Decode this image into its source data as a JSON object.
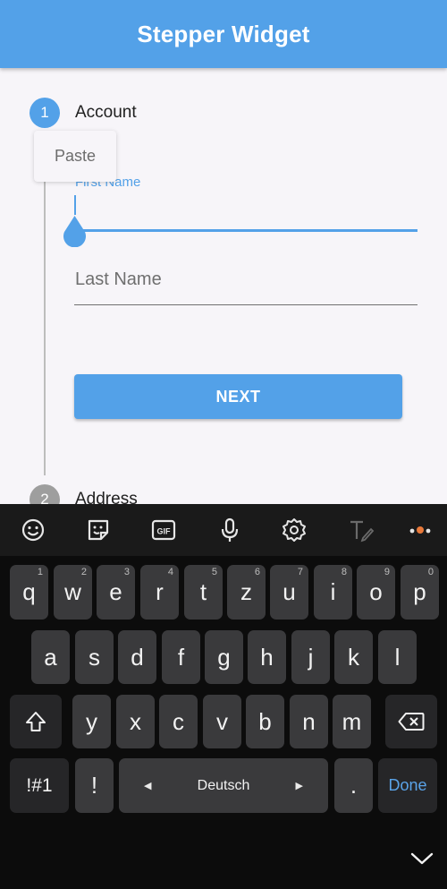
{
  "appbar": {
    "title": "Stepper Widget"
  },
  "stepper": {
    "steps": [
      {
        "number": "1",
        "title": "Account"
      },
      {
        "number": "2",
        "title": "Address"
      }
    ],
    "paste_menu_label": "Paste",
    "first_name": {
      "label": "First Name",
      "value": ""
    },
    "last_name": {
      "placeholder": "Last Name",
      "value": ""
    },
    "next_button": "NEXT"
  },
  "colors": {
    "primary": "#53a1e8",
    "inactive_step": "#9e9e9e",
    "keyboard_bg": "#0c0c0c",
    "key_bg": "#3a3a3c",
    "notification_dot": "#e8793a"
  },
  "keyboard": {
    "toolbar_icons": [
      "emoji-icon",
      "sticker-icon",
      "gif-icon",
      "mic-icon",
      "settings-icon",
      "handwriting-icon",
      "more-icon"
    ],
    "toolbar_gif_label": "GIF",
    "row1": [
      {
        "k": "q",
        "n": "1"
      },
      {
        "k": "w",
        "n": "2"
      },
      {
        "k": "e",
        "n": "3"
      },
      {
        "k": "r",
        "n": "4"
      },
      {
        "k": "t",
        "n": "5"
      },
      {
        "k": "z",
        "n": "6"
      },
      {
        "k": "u",
        "n": "7"
      },
      {
        "k": "i",
        "n": "8"
      },
      {
        "k": "o",
        "n": "9"
      },
      {
        "k": "p",
        "n": "0"
      }
    ],
    "row2": [
      "a",
      "s",
      "d",
      "f",
      "g",
      "h",
      "j",
      "k",
      "l"
    ],
    "row3": [
      "y",
      "x",
      "c",
      "v",
      "b",
      "n",
      "m"
    ],
    "symbols_key": "!#1",
    "exclaim_key": "!",
    "space_label": "Deutsch",
    "period_key": ".",
    "done_key": "Done"
  }
}
